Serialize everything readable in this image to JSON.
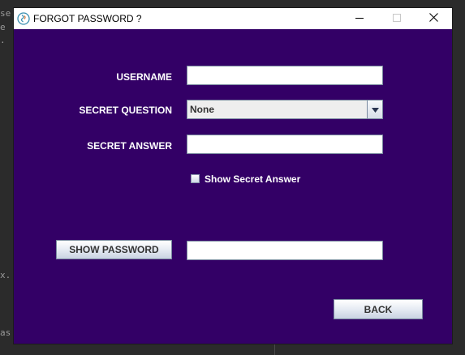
{
  "window": {
    "title": "FORGOT PASSWORD ?",
    "controls": {
      "minimize": "minimize",
      "maximize": "maximize",
      "close": "close"
    }
  },
  "form": {
    "username_label": "USERNAME",
    "username_value": "",
    "question_label": "SECRET QUESTION",
    "question_value": "None",
    "answer_label": "SECRET ANSWER",
    "answer_value": "",
    "show_answer_label": "Show Secret Answer",
    "show_answer_checked": false,
    "show_password_button": "SHOW PASSWORD",
    "password_value": "",
    "back_button": "BACK"
  },
  "background": {
    "fragments": [
      "se",
      "e",
      ".",
      "x.",
      "as"
    ]
  },
  "colors": {
    "dialog_background": "#330066",
    "titlebar": "#ffffff",
    "label_text": "#ffffff"
  }
}
